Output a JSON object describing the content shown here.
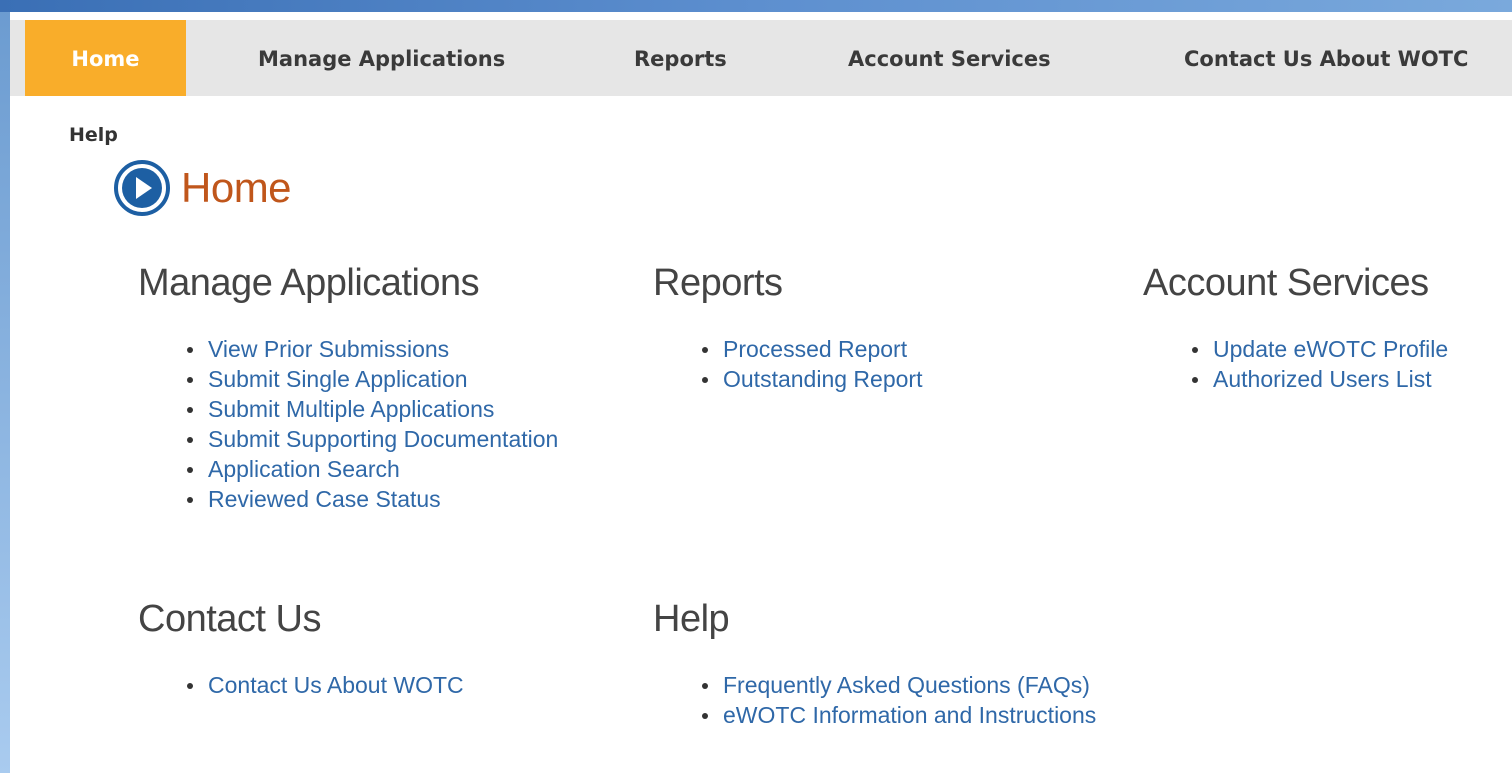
{
  "nav": {
    "items": [
      {
        "label": "Home",
        "active": true
      },
      {
        "label": "Manage Applications",
        "active": false
      },
      {
        "label": "Reports",
        "active": false
      },
      {
        "label": "Account Services",
        "active": false
      },
      {
        "label": "Contact Us About WOTC",
        "active": false
      }
    ]
  },
  "help_link": "Help",
  "page_title": "Home",
  "sections": {
    "manage_applications": {
      "heading": "Manage Applications",
      "links": [
        "View Prior Submissions",
        "Submit Single Application",
        "Submit Multiple Applications",
        "Submit Supporting Documentation",
        "Application Search",
        "Reviewed Case Status"
      ]
    },
    "reports": {
      "heading": "Reports",
      "links": [
        "Processed Report",
        "Outstanding Report"
      ]
    },
    "account_services": {
      "heading": "Account Services",
      "links": [
        "Update eWOTC Profile",
        "Authorized Users List"
      ]
    },
    "contact_us": {
      "heading": "Contact Us",
      "links": [
        "Contact Us About WOTC"
      ]
    },
    "help": {
      "heading": "Help",
      "links": [
        "Frequently Asked Questions (FAQs)",
        "eWOTC Information and Instructions"
      ]
    }
  },
  "colors": {
    "nav_active_bg": "#f9ad2a",
    "nav_bg": "#e6e6e6",
    "title_color": "#c0561b",
    "link_color": "#2f68a8",
    "icon_blue": "#1d5fa3"
  },
  "icons": {
    "title_icon": "play-circle-icon"
  }
}
